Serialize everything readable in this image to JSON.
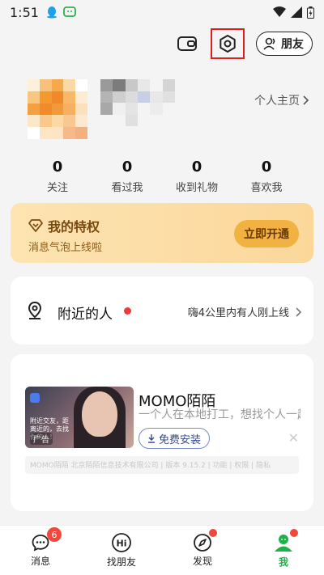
{
  "status_bar": {
    "time": "1:51"
  },
  "topbar": {
    "friends_label": "朋友"
  },
  "profile": {
    "homepage_label": "个人主页"
  },
  "stats": [
    {
      "num": "0",
      "label": "关注"
    },
    {
      "num": "0",
      "label": "看过我"
    },
    {
      "num": "0",
      "label": "收到礼物"
    },
    {
      "num": "0",
      "label": "喜欢我"
    }
  ],
  "privilege": {
    "title": "我的特权",
    "subtitle": "消息气泡上线啦",
    "button": "立即开通"
  },
  "nearby": {
    "label": "附近的人",
    "desc": "嗨4公里内有人刚上线"
  },
  "ad": {
    "app_name": "MOMO陌陌",
    "slogan": "一个人在本地打工，想找个人一起",
    "install": "免费安装",
    "ad_tag": "广告",
    "thumb_text": "附近交友，距离近的，去找你的人！",
    "meta": "MOMO陌陌 北京陌陌信息技术有限公司 | 版本 9.15.2 | 功能 | 权限 | 隐私"
  },
  "tabs": [
    {
      "label": "消息",
      "badge": "6"
    },
    {
      "label": "找朋友"
    },
    {
      "label": "发现"
    },
    {
      "label": "我"
    }
  ],
  "colors": {
    "accent": "#20b04a",
    "badge": "#f0483a",
    "privilege_button": "#f1b241"
  }
}
